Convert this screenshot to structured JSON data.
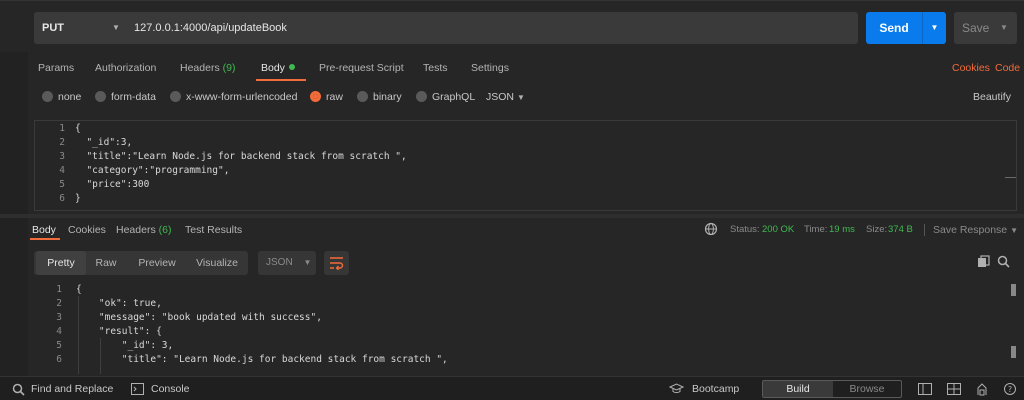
{
  "request": {
    "method": "PUT",
    "url": "127.0.0.1:4000/api/updateBook",
    "send_label": "Send",
    "save_label": "Save"
  },
  "request_tabs": {
    "params": "Params",
    "authorization": "Authorization",
    "headers": "Headers",
    "headers_count": "(9)",
    "body": "Body",
    "prerequest": "Pre-request Script",
    "tests": "Tests",
    "settings": "Settings",
    "cookies": "Cookies",
    "code": "Code"
  },
  "body_types": {
    "none": "none",
    "form_data": "form-data",
    "urlencoded": "x-www-form-urlencoded",
    "raw": "raw",
    "binary": "binary",
    "graphql": "GraphQL",
    "format": "JSON",
    "beautify": "Beautify",
    "selected": "raw"
  },
  "request_body": {
    "line_numbers": [
      "1",
      "2",
      "3",
      "4",
      "5",
      "6"
    ],
    "lines": [
      "{",
      "  \"_id\":3,",
      "  \"title\":\"Learn Node.js for backend stack from scratch \",",
      "  \"category\":\"programming\",",
      "  \"price\":300",
      "}"
    ]
  },
  "response_tabs": {
    "body": "Body",
    "cookies": "Cookies",
    "headers": "Headers",
    "headers_count": "(6)",
    "test_results": "Test Results"
  },
  "response_meta": {
    "status_label": "Status:",
    "status_value": "200 OK",
    "time_label": "Time:",
    "time_value": "19 ms",
    "size_label": "Size:",
    "size_value": "374 B",
    "save_response": "Save Response"
  },
  "response_view": {
    "pretty": "Pretty",
    "raw": "Raw",
    "preview": "Preview",
    "visualize": "Visualize",
    "format": "JSON"
  },
  "response_body": {
    "line_numbers": [
      "1",
      "2",
      "3",
      "4",
      "5",
      "6"
    ],
    "lines": [
      "{",
      "    \"ok\": true,",
      "    \"message\": \"book updated with success\",",
      "    \"result\": {",
      "        \"_id\": 3,",
      "        \"title\": \"Learn Node.js for backend stack from scratch \","
    ]
  },
  "status_bar": {
    "find_replace": "Find and Replace",
    "console": "Console",
    "bootcamp": "Bootcamp",
    "build": "Build",
    "browse": "Browse"
  },
  "colors": {
    "accent": "#f26b3a",
    "send": "#097bed",
    "success": "#3fb950"
  }
}
